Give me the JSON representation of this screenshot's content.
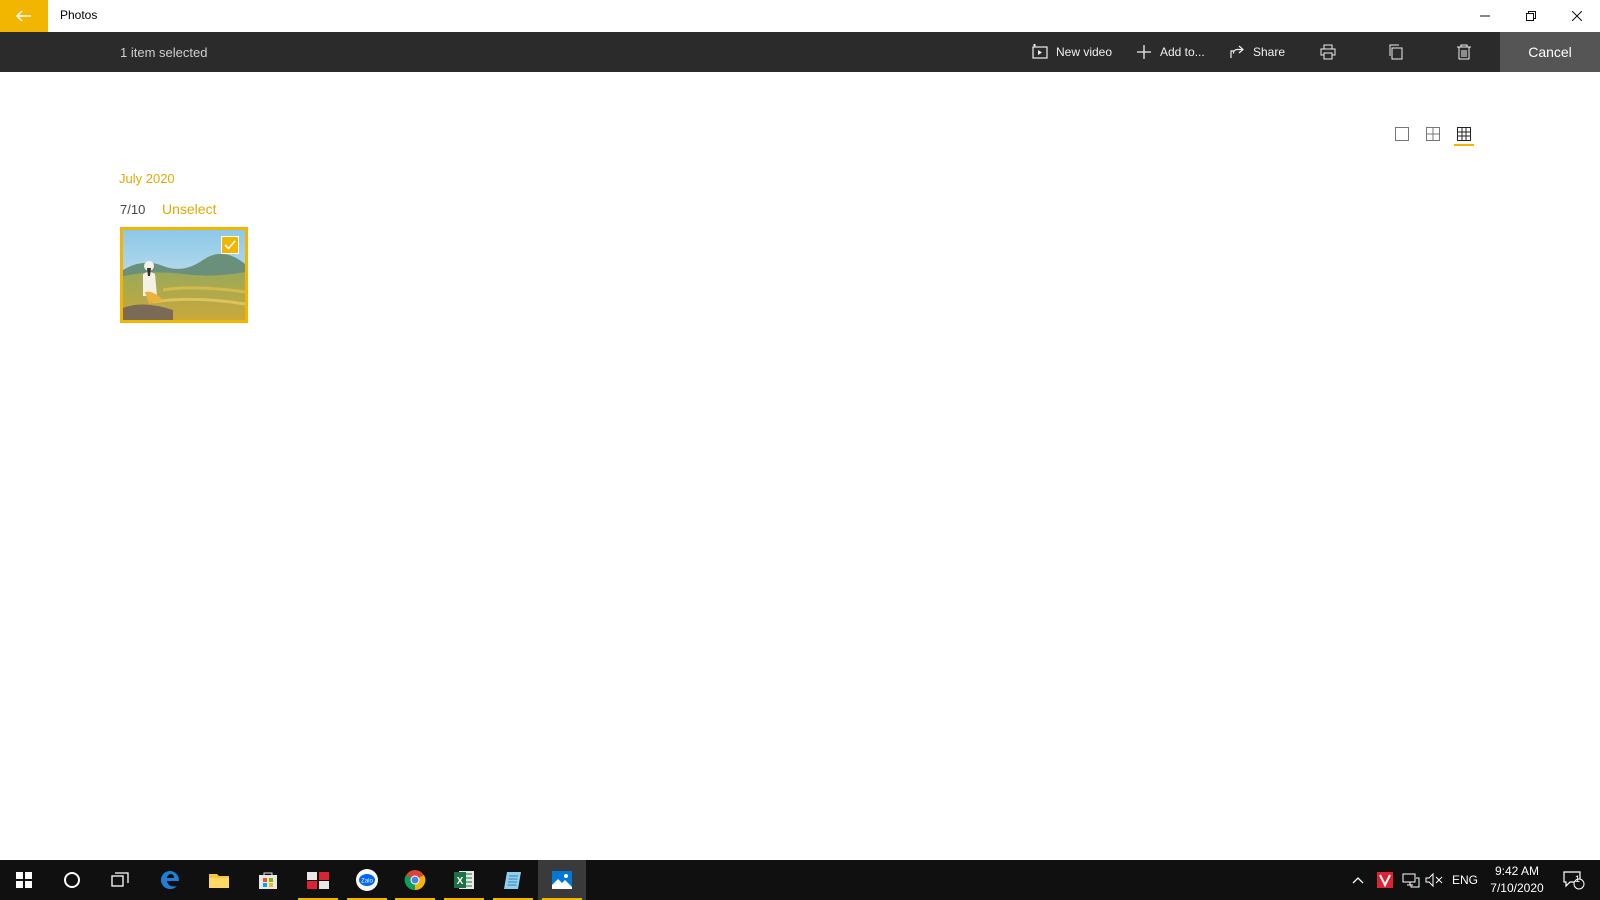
{
  "window": {
    "title": "Photos",
    "controls": {
      "minimize": "—",
      "maximize": "❐",
      "close": "✕"
    }
  },
  "commandbar": {
    "selection_text": "1 item selected",
    "new_video_label": "New video",
    "add_to_label": "Add to...",
    "share_label": "Share",
    "cancel_label": "Cancel"
  },
  "content": {
    "month": "July 2020",
    "day": "7/10",
    "unselect_label": "Unselect",
    "selected_count": 1
  },
  "taskbar": {
    "apps": [
      "windows-start-icon",
      "cortana-search-icon",
      "task-view-icon",
      "edge-icon",
      "file-explorer-icon",
      "store-icon",
      "unikey-icon",
      "zalo-icon",
      "chrome-icon",
      "excel-icon",
      "notepad-icon",
      "photos-icon"
    ],
    "zalo_label": "Zalo",
    "excel_label": "X",
    "language": "ENG",
    "time": "9:42 AM",
    "date": "7/10/2020",
    "notification_count": "1"
  },
  "colors": {
    "accent": "#f2b500",
    "commandbar_bg": "#2b2b2b",
    "cancel_bg": "#555555",
    "taskbar_bg": "#101010"
  }
}
